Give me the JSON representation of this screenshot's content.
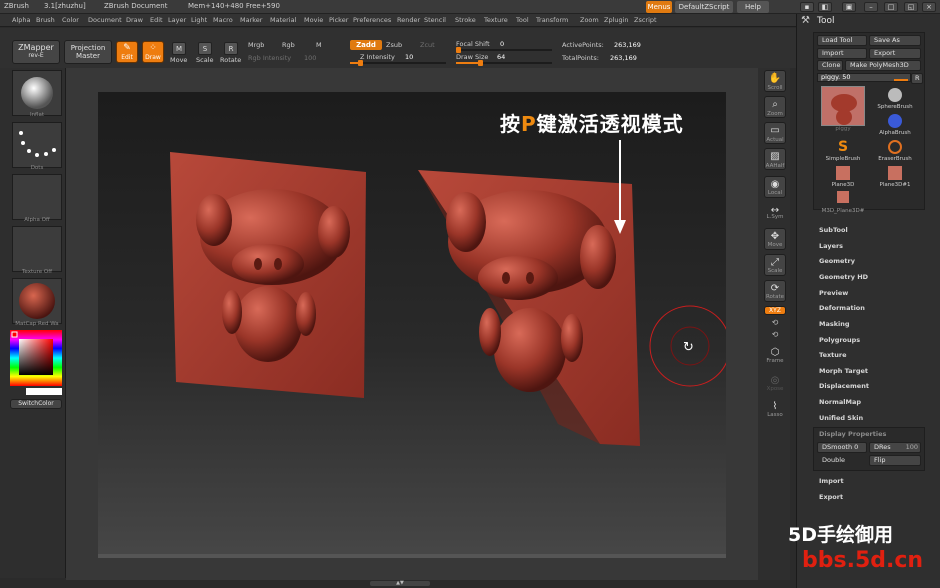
{
  "titlebar": {
    "app": "ZBrush",
    "version": "3.1[zhuzhu]",
    "document": "ZBrush Document",
    "mem": "Mem+140+480 Free+590",
    "menus_btn": "Menus",
    "script_btn": "DefaultZScript",
    "help_btn": "Help"
  },
  "menubar": [
    "Alpha",
    "Brush",
    "Color",
    "Document",
    "Draw",
    "Edit",
    "Layer",
    "Light",
    "Macro",
    "Marker",
    "Material",
    "Movie",
    "Picker",
    "Preferences",
    "Render",
    "Stencil",
    "Stroke",
    "Texture",
    "Tool",
    "Transform",
    "Zoom",
    "Zplugin",
    "Zscript"
  ],
  "shelf": {
    "zmapper": "ZMapper",
    "zmapper_sub": "rev-E",
    "projection": "Projection",
    "projection_sub": "Master",
    "edit": "Edit",
    "draw": "Draw",
    "move": "Move",
    "scale": "Scale",
    "rotate": "Rotate",
    "mrgb": "Mrgb",
    "rgb": "Rgb",
    "m": "M",
    "rgb_intensity_label": "Rgb Intensity",
    "rgb_intensity_value": "100",
    "zadd": "Zadd",
    "zsub": "Zsub",
    "zcut": "Zcut",
    "z_intensity_label": "Z Intensity",
    "z_intensity_value": "10",
    "z_intensity": 0.1,
    "focal_shift_label": "Focal Shift",
    "focal_shift_value": "0",
    "focal_shift": 0.0,
    "draw_size_label": "Draw Size",
    "draw_size_value": "64",
    "draw_size": 0.25,
    "active_points_label": "ActivePoints:",
    "active_points_value": "263,169",
    "total_points_label": "TotalPoints:",
    "total_points_value": "263,169"
  },
  "lefttray": {
    "inflat": "Inflat",
    "dots": "Dots",
    "alpha": "Alpha Off",
    "texture": "Texture Off",
    "matcap": "MatCap Red Wa",
    "switchcolor": "SwitchColor"
  },
  "rightshelf": [
    "Scroll",
    "Zoom",
    "Actual",
    "AAHalf",
    "Local",
    "L.Sym",
    "Move",
    "Scale",
    "Rotate",
    "XYZ",
    "Frame",
    "Xpose",
    "Lasso"
  ],
  "toolpanel": {
    "title": "Tool",
    "load_tool": "Load Tool",
    "save_as": "Save As",
    "import": "Import",
    "export": "Export",
    "clone": "Clone",
    "make_polymesh": "Make PolyMesh3D",
    "current_tool": "piggy. 50",
    "r_btn": "R",
    "tools": [
      {
        "name": "piggy"
      },
      {
        "name": "SphereBrush"
      },
      {
        "name": "AlphaBrush"
      },
      {
        "name": "SimpleBrush"
      },
      {
        "name": "EraserBrush"
      },
      {
        "name": "Plane3D"
      },
      {
        "name": "Plane3D#1"
      },
      {
        "name": "M3D_Plane3D#"
      }
    ],
    "subpalettes": [
      "SubTool",
      "Layers",
      "Geometry",
      "Geometry HD",
      "Preview",
      "Deformation",
      "Masking",
      "Polygroups",
      "Texture",
      "Morph Target",
      "Displacement",
      "NormalMap",
      "Unified Skin"
    ],
    "display_properties": "Display Properties",
    "dsmooth_label": "DSmooth",
    "dsmooth_value": "0",
    "dres_label": "DRes",
    "dres_value": "100",
    "double": "Double",
    "flip": "Flip",
    "import2": "Import",
    "export2": "Export"
  },
  "annotation": {
    "pre": "按",
    "key": "P",
    "post": "键激活透视模式"
  },
  "watermark": {
    "line1": "5D手绘御用",
    "line2": "bbs.5d.cn"
  },
  "colors": {
    "accent": "#ee7d10",
    "model": "#a33a2c",
    "canvas_top": "#1c1c1c",
    "watermark_red": "#e02010"
  }
}
